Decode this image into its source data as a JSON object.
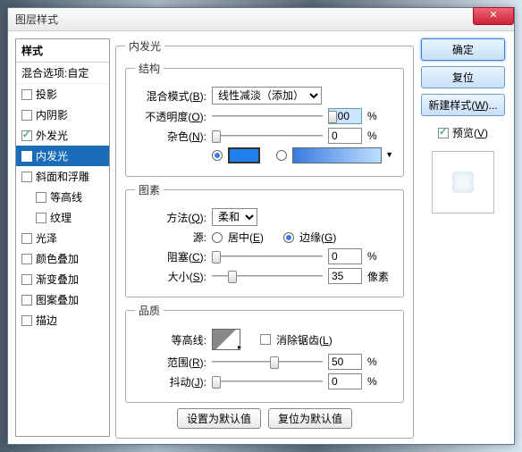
{
  "window": {
    "title": "图层样式"
  },
  "sidebar": {
    "header": "样式",
    "sub": "混合选项:自定",
    "items": [
      {
        "label": "投影",
        "checked": false,
        "selected": false
      },
      {
        "label": "内阴影",
        "checked": false,
        "selected": false
      },
      {
        "label": "外发光",
        "checked": true,
        "selected": false
      },
      {
        "label": "内发光",
        "checked": true,
        "selected": true
      },
      {
        "label": "斜面和浮雕",
        "checked": false,
        "selected": false
      },
      {
        "label": "等高线",
        "checked": false,
        "selected": false,
        "indent": true
      },
      {
        "label": "纹理",
        "checked": false,
        "selected": false,
        "indent": true
      },
      {
        "label": "光泽",
        "checked": false,
        "selected": false
      },
      {
        "label": "颜色叠加",
        "checked": false,
        "selected": false
      },
      {
        "label": "渐变叠加",
        "checked": false,
        "selected": false
      },
      {
        "label": "图案叠加",
        "checked": false,
        "selected": false
      },
      {
        "label": "描边",
        "checked": false,
        "selected": false
      }
    ]
  },
  "panel": {
    "title": "内发光"
  },
  "structure": {
    "legend": "结构",
    "blend_label": "混合模式(",
    "blend_key": "B",
    "blend_label2": "):",
    "blend_value": "线性减淡（添加）",
    "opacity_label": "不透明度(",
    "opacity_key": "O",
    "opacity_label2": "):",
    "opacity_value": "100",
    "opacity_unit": "%",
    "noise_label": "杂色(",
    "noise_key": "N",
    "noise_label2": "):",
    "noise_value": "0",
    "noise_unit": "%",
    "color_solid": "#2080f0"
  },
  "elements": {
    "legend": "图素",
    "method_label": "方法(",
    "method_key": "Q",
    "method_label2": "):",
    "method_value": "柔和",
    "source_label": "源:",
    "source_center": "居中(",
    "source_center_key": "E",
    "source_center2": ")",
    "source_edge": "边缘(",
    "source_edge_key": "G",
    "source_edge2": ")",
    "choke_label": "阻塞(",
    "choke_key": "C",
    "choke_label2": "):",
    "choke_value": "0",
    "choke_unit": "%",
    "size_label": "大小(",
    "size_key": "S",
    "size_label2": "):",
    "size_value": "35",
    "size_unit": "像素"
  },
  "quality": {
    "legend": "品质",
    "contour_label": "等高线:",
    "aa_label": "消除锯齿(",
    "aa_key": "L",
    "aa_label2": ")",
    "range_label": "范围(",
    "range_key": "R",
    "range_label2": "):",
    "range_value": "50",
    "range_unit": "%",
    "jitter_label": "抖动(",
    "jitter_key": "J",
    "jitter_label2": "):",
    "jitter_value": "0",
    "jitter_unit": "%"
  },
  "buttons": {
    "set_default": "设置为默认值",
    "reset_default": "复位为默认值",
    "ok": "确定",
    "cancel": "复位",
    "new_style": "新建样式(",
    "new_style_key": "W",
    "new_style2": ")...",
    "preview": "预览(",
    "preview_key": "V",
    "preview2": ")"
  }
}
